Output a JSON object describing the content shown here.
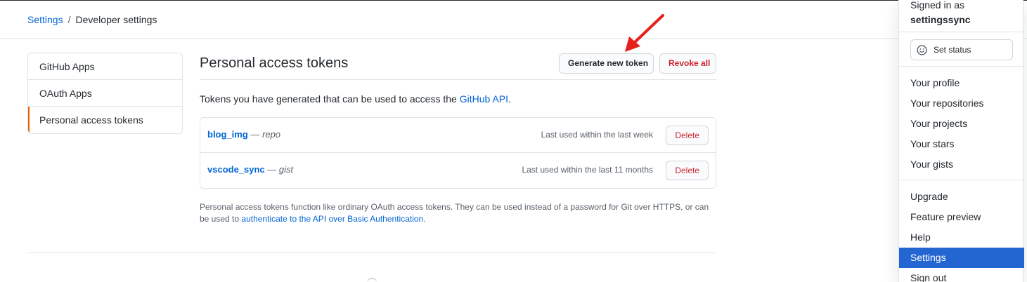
{
  "breadcrumb": {
    "root": "Settings",
    "separator": "/",
    "current": "Developer settings"
  },
  "sidebar": {
    "items": [
      {
        "label": "GitHub Apps"
      },
      {
        "label": "OAuth Apps"
      },
      {
        "label": "Personal access tokens",
        "selected": true
      }
    ]
  },
  "main": {
    "title": "Personal access tokens",
    "generate_button": "Generate new token",
    "revoke_button": "Revoke all",
    "intro_text": "Tokens you have generated that can be used to access the ",
    "intro_link": "GitHub API",
    "intro_end": ".",
    "tokens": [
      {
        "name": "blog_img",
        "dash": " — ",
        "scope": "repo",
        "last_used": "Last used within the last week",
        "delete_label": "Delete"
      },
      {
        "name": "vscode_sync",
        "dash": " — ",
        "scope": "gist",
        "last_used": "Last used within the last 11 months",
        "delete_label": "Delete"
      }
    ],
    "note_text": "Personal access tokens function like ordinary OAuth access tokens. They can be used instead of a password for Git over HTTPS, or can be used to ",
    "note_link": "authenticate to the API over Basic Authentication",
    "note_end": "."
  },
  "user_menu": {
    "signed_in_label": "Signed in as",
    "username": "settingssync",
    "set_status": "Set status",
    "items": [
      {
        "label": "Your profile"
      },
      {
        "label": "Your repositories"
      },
      {
        "label": "Your projects"
      },
      {
        "label": "Your stars"
      },
      {
        "label": "Your gists"
      },
      {
        "label": "Upgrade"
      },
      {
        "label": "Feature preview"
      },
      {
        "label": "Help"
      },
      {
        "label": "Settings",
        "active": true
      },
      {
        "label": "Sign out"
      }
    ]
  },
  "colors": {
    "link": "#0366d6",
    "danger": "#cb2431",
    "selected_accent": "#e36209",
    "menu_active": "#2366d1",
    "annotation_arrow": "#e8201c"
  },
  "icons": {
    "status": "smiley-icon",
    "annotation": "red-arrow-icon"
  }
}
